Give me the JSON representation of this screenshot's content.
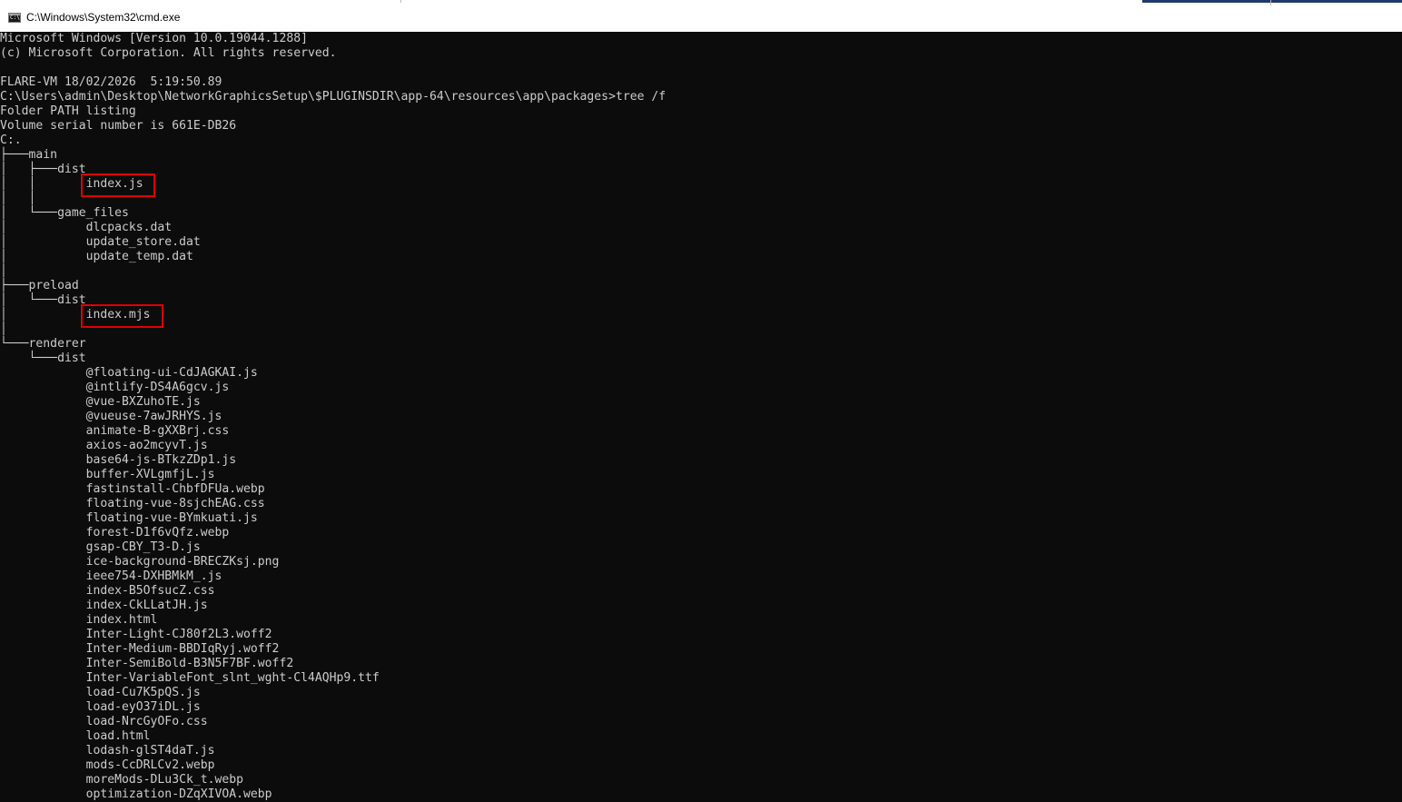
{
  "window": {
    "title": "C:\\Windows\\System32\\cmd.exe",
    "icon": "cmd-icon"
  },
  "console": {
    "lines": [
      "Microsoft Windows [Version 10.0.19044.1288]",
      "(c) Microsoft Corporation. All rights reserved.",
      "",
      "FLARE-VM 18/02/2026  5:19:50.89",
      "C:\\Users\\admin\\Desktop\\NetworkGraphicsSetup\\$PLUGINSDIR\\app-64\\resources\\app\\packages>tree /f",
      "Folder PATH listing",
      "Volume serial number is 661E-DB26",
      "C:.",
      "├───main",
      "│   ├───dist",
      "│   │       index.js",
      "│   │",
      "│   └───game_files",
      "│           dlcpacks.dat",
      "│           update_store.dat",
      "│           update_temp.dat",
      "│",
      "├───preload",
      "│   └───dist",
      "│           index.mjs",
      "│",
      "└───renderer",
      "    └───dist",
      "            @floating-ui-CdJAGKAI.js",
      "            @intlify-DS4A6gcv.js",
      "            @vue-BXZuhoTE.js",
      "            @vueuse-7awJRHYS.js",
      "            animate-B-gXXBrj.css",
      "            axios-ao2mcyvT.js",
      "            base64-js-BTkzZDp1.js",
      "            buffer-XVLgmfjL.js",
      "            fastinstall-ChbfDFUa.webp",
      "            floating-vue-8sjchEAG.css",
      "            floating-vue-BYmkuati.js",
      "            forest-D1f6vQfz.webp",
      "            gsap-CBY_T3-D.js",
      "            ice-background-BRECZKsj.png",
      "            ieee754-DXHBMkM_.js",
      "            index-B5OfsucZ.css",
      "            index-CkLLatJH.js",
      "            index.html",
      "            Inter-Light-CJ80f2L3.woff2",
      "            Inter-Medium-BBDIqRyj.woff2",
      "            Inter-SemiBold-B3N5F7BF.woff2",
      "            Inter-VariableFont_slnt_wght-Cl4AQHp9.ttf",
      "            load-Cu7K5pQS.js",
      "            load-eyO37iDL.js",
      "            load-NrcGyOFo.css",
      "            load.html",
      "            lodash-glST4daT.js",
      "            mods-CcDRLCv2.webp",
      "            moreMods-DLu3Ck_t.webp",
      "            optimization-DZqXIVOA.webp"
    ]
  },
  "annotations": {
    "highlight_color": "#e00000",
    "highlighted_items": [
      "index.js",
      "index.mjs"
    ]
  }
}
